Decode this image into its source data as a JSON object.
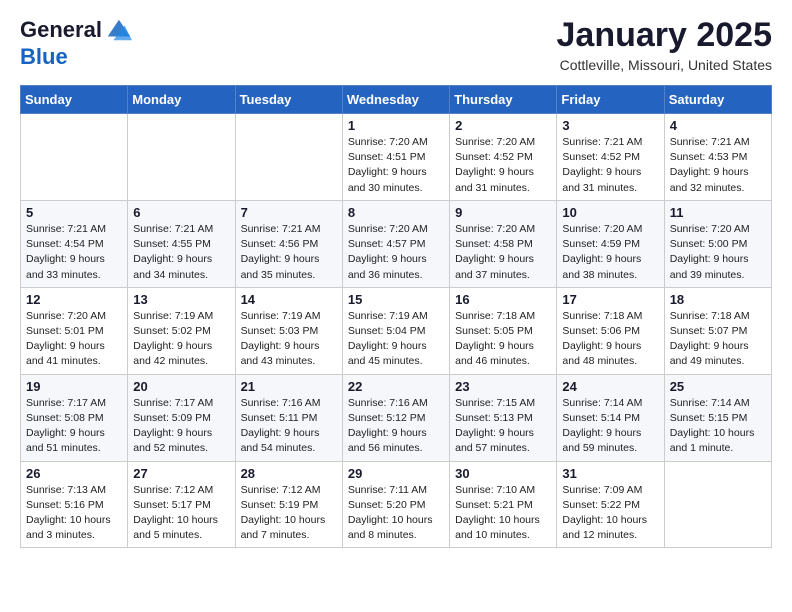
{
  "header": {
    "logo_line1": "General",
    "logo_line2": "Blue",
    "month": "January 2025",
    "location": "Cottleville, Missouri, United States"
  },
  "weekdays": [
    "Sunday",
    "Monday",
    "Tuesday",
    "Wednesday",
    "Thursday",
    "Friday",
    "Saturday"
  ],
  "weeks": [
    [
      {
        "day": "",
        "info": ""
      },
      {
        "day": "",
        "info": ""
      },
      {
        "day": "",
        "info": ""
      },
      {
        "day": "1",
        "info": "Sunrise: 7:20 AM\nSunset: 4:51 PM\nDaylight: 9 hours\nand 30 minutes."
      },
      {
        "day": "2",
        "info": "Sunrise: 7:20 AM\nSunset: 4:52 PM\nDaylight: 9 hours\nand 31 minutes."
      },
      {
        "day": "3",
        "info": "Sunrise: 7:21 AM\nSunset: 4:52 PM\nDaylight: 9 hours\nand 31 minutes."
      },
      {
        "day": "4",
        "info": "Sunrise: 7:21 AM\nSunset: 4:53 PM\nDaylight: 9 hours\nand 32 minutes."
      }
    ],
    [
      {
        "day": "5",
        "info": "Sunrise: 7:21 AM\nSunset: 4:54 PM\nDaylight: 9 hours\nand 33 minutes."
      },
      {
        "day": "6",
        "info": "Sunrise: 7:21 AM\nSunset: 4:55 PM\nDaylight: 9 hours\nand 34 minutes."
      },
      {
        "day": "7",
        "info": "Sunrise: 7:21 AM\nSunset: 4:56 PM\nDaylight: 9 hours\nand 35 minutes."
      },
      {
        "day": "8",
        "info": "Sunrise: 7:20 AM\nSunset: 4:57 PM\nDaylight: 9 hours\nand 36 minutes."
      },
      {
        "day": "9",
        "info": "Sunrise: 7:20 AM\nSunset: 4:58 PM\nDaylight: 9 hours\nand 37 minutes."
      },
      {
        "day": "10",
        "info": "Sunrise: 7:20 AM\nSunset: 4:59 PM\nDaylight: 9 hours\nand 38 minutes."
      },
      {
        "day": "11",
        "info": "Sunrise: 7:20 AM\nSunset: 5:00 PM\nDaylight: 9 hours\nand 39 minutes."
      }
    ],
    [
      {
        "day": "12",
        "info": "Sunrise: 7:20 AM\nSunset: 5:01 PM\nDaylight: 9 hours\nand 41 minutes."
      },
      {
        "day": "13",
        "info": "Sunrise: 7:19 AM\nSunset: 5:02 PM\nDaylight: 9 hours\nand 42 minutes."
      },
      {
        "day": "14",
        "info": "Sunrise: 7:19 AM\nSunset: 5:03 PM\nDaylight: 9 hours\nand 43 minutes."
      },
      {
        "day": "15",
        "info": "Sunrise: 7:19 AM\nSunset: 5:04 PM\nDaylight: 9 hours\nand 45 minutes."
      },
      {
        "day": "16",
        "info": "Sunrise: 7:18 AM\nSunset: 5:05 PM\nDaylight: 9 hours\nand 46 minutes."
      },
      {
        "day": "17",
        "info": "Sunrise: 7:18 AM\nSunset: 5:06 PM\nDaylight: 9 hours\nand 48 minutes."
      },
      {
        "day": "18",
        "info": "Sunrise: 7:18 AM\nSunset: 5:07 PM\nDaylight: 9 hours\nand 49 minutes."
      }
    ],
    [
      {
        "day": "19",
        "info": "Sunrise: 7:17 AM\nSunset: 5:08 PM\nDaylight: 9 hours\nand 51 minutes."
      },
      {
        "day": "20",
        "info": "Sunrise: 7:17 AM\nSunset: 5:09 PM\nDaylight: 9 hours\nand 52 minutes."
      },
      {
        "day": "21",
        "info": "Sunrise: 7:16 AM\nSunset: 5:11 PM\nDaylight: 9 hours\nand 54 minutes."
      },
      {
        "day": "22",
        "info": "Sunrise: 7:16 AM\nSunset: 5:12 PM\nDaylight: 9 hours\nand 56 minutes."
      },
      {
        "day": "23",
        "info": "Sunrise: 7:15 AM\nSunset: 5:13 PM\nDaylight: 9 hours\nand 57 minutes."
      },
      {
        "day": "24",
        "info": "Sunrise: 7:14 AM\nSunset: 5:14 PM\nDaylight: 9 hours\nand 59 minutes."
      },
      {
        "day": "25",
        "info": "Sunrise: 7:14 AM\nSunset: 5:15 PM\nDaylight: 10 hours\nand 1 minute."
      }
    ],
    [
      {
        "day": "26",
        "info": "Sunrise: 7:13 AM\nSunset: 5:16 PM\nDaylight: 10 hours\nand 3 minutes."
      },
      {
        "day": "27",
        "info": "Sunrise: 7:12 AM\nSunset: 5:17 PM\nDaylight: 10 hours\nand 5 minutes."
      },
      {
        "day": "28",
        "info": "Sunrise: 7:12 AM\nSunset: 5:19 PM\nDaylight: 10 hours\nand 7 minutes."
      },
      {
        "day": "29",
        "info": "Sunrise: 7:11 AM\nSunset: 5:20 PM\nDaylight: 10 hours\nand 8 minutes."
      },
      {
        "day": "30",
        "info": "Sunrise: 7:10 AM\nSunset: 5:21 PM\nDaylight: 10 hours\nand 10 minutes."
      },
      {
        "day": "31",
        "info": "Sunrise: 7:09 AM\nSunset: 5:22 PM\nDaylight: 10 hours\nand 12 minutes."
      },
      {
        "day": "",
        "info": ""
      }
    ]
  ]
}
